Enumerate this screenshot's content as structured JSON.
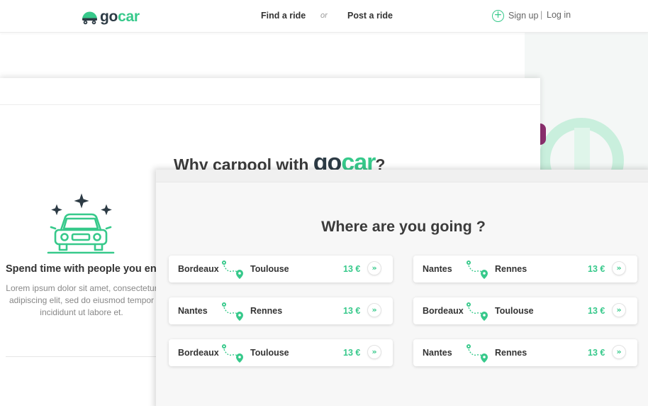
{
  "header": {
    "logo_go": "go",
    "logo_car": "car",
    "nav": {
      "find_ride": "Find a ride",
      "or": "or",
      "post_ride": "Post a ride"
    },
    "auth": {
      "signup": "Sign up",
      "separator": "|",
      "login": "Log in"
    }
  },
  "why_section": {
    "title_prefix": "Why carpool with ",
    "brand_go": "go",
    "brand_car": "car",
    "title_suffix": "?",
    "feature_title": "Spend time with people you enjoy",
    "feature_text": "Lorem ipsum dolor sit amet, consectetur adipiscing elit, sed do eiusmod tempor incididunt ut labore et."
  },
  "going_section": {
    "title": "Where are you going ?",
    "rides": [
      {
        "from": "Bordeaux",
        "to": "Toulouse",
        "price": "13 €"
      },
      {
        "from": "Nantes",
        "to": "Rennes",
        "price": "13 €"
      },
      {
        "from": "Nantes",
        "to": "Rennes",
        "price": "13 €"
      },
      {
        "from": "Bordeaux",
        "to": "Toulouse",
        "price": "13 €"
      },
      {
        "from": "Bordeaux",
        "to": "Toulouse",
        "price": "13 €"
      },
      {
        "from": "Nantes",
        "to": "Rennes",
        "price": "13 €"
      }
    ]
  },
  "icons": {
    "logo": "gocar-logo-icon",
    "signup": "plus-circle-icon",
    "car": "car-illustration-icon",
    "route": "route-pin-icon",
    "go": "chevron-double-right-icon"
  },
  "colors": {
    "accent": "#37c98b",
    "dark": "#2d3b45",
    "text": "#333333",
    "muted": "#888888"
  }
}
